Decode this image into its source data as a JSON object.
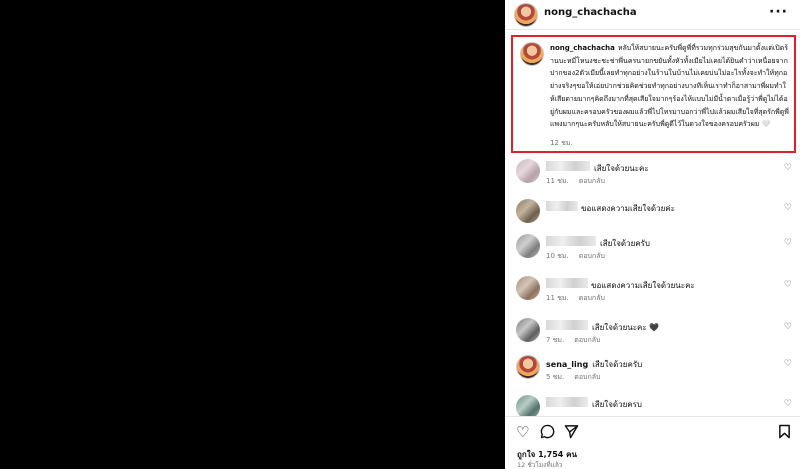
{
  "header": {
    "username": "nong_chachacha",
    "more_icon": "more-horizontal-icon"
  },
  "caption": {
    "username": "nong_chachacha",
    "text": "หลับให้สบายนะครับพี่ดูพี่ที่รวมทุกร่วมสุขกันมาตั้งแต่เปิดร้านบะหมี่โหนงชะชะช่าพี่นครนายกขยันทั้งหัวทั้งเมียไม่เคยได้ยินคำว่าเหนื่อยจากปากของ2ตัวเมียนี้เลยทำทุกอย่างในร้านในบ้านไม่เคยบ่นไม่อะไรทั้งจะทำให้ทุกอย่างจริงๆขอให้เอ่ยปากช่วยคิดช่วยทำทุกอย่างบางทีเห็นเราทำก็อาสามาพี่ผมทำให้เสียดายมากๆคิดถึงมากที่สุดเสียใจมากๆร้องไห้แบบไม่มีน้ำตาเมื่อรู้ว่าพี่ดูไม่ได้อยู่กับผมและครอบครัวของผมแล้วพี่ไปโทรมาบอกว่าพี่ไปแล้วผมเสียใจที่สุดรักพี่ดูพี่แพงมากๆนะครับหลับให้สบายนะครับพี่ดูดีไว้ในดวงใจของครอบครัวผม 🤍",
    "time": "12 ชม."
  },
  "comments": [
    {
      "name": "",
      "text": "เสียใจด้วยนะคะ",
      "time": "11 ชม.",
      "reply": "ตอบกลับ"
    },
    {
      "name": "",
      "text": "ขอแสดงความเสียใจด้วยค่ะ",
      "time": "11 ชม.",
      "reply": "ตอบกลับ"
    },
    {
      "name": "",
      "text": "เสียใจด้วยครับ",
      "time": "10 ชม.",
      "reply": "ตอบกลับ"
    },
    {
      "name": "",
      "text": "ขอแสดงความเสียใจด้วยนะคะ",
      "time": "11 ชม.",
      "reply": "ตอบกลับ"
    },
    {
      "name": "",
      "text": "เสียใจด้วยนะคะ 🖤",
      "time": "7 ชม.",
      "reply": "ตอบกลับ"
    },
    {
      "name": "sena_ling",
      "text": "เสียใจด้วยครับ",
      "time": "5 ชม.",
      "reply": "ตอบกลับ"
    },
    {
      "name": "",
      "text": "เสียใจด้วยครบ",
      "time": "",
      "reply": ""
    }
  ],
  "actions": {
    "like_icon": "heart-icon",
    "comment_icon": "comment-icon",
    "share_icon": "share-icon",
    "save_icon": "bookmark-icon",
    "likes": "ถูกใจ 1,754 คน",
    "posted_ago": "12 ชั่วโมงที่แล้ว"
  }
}
